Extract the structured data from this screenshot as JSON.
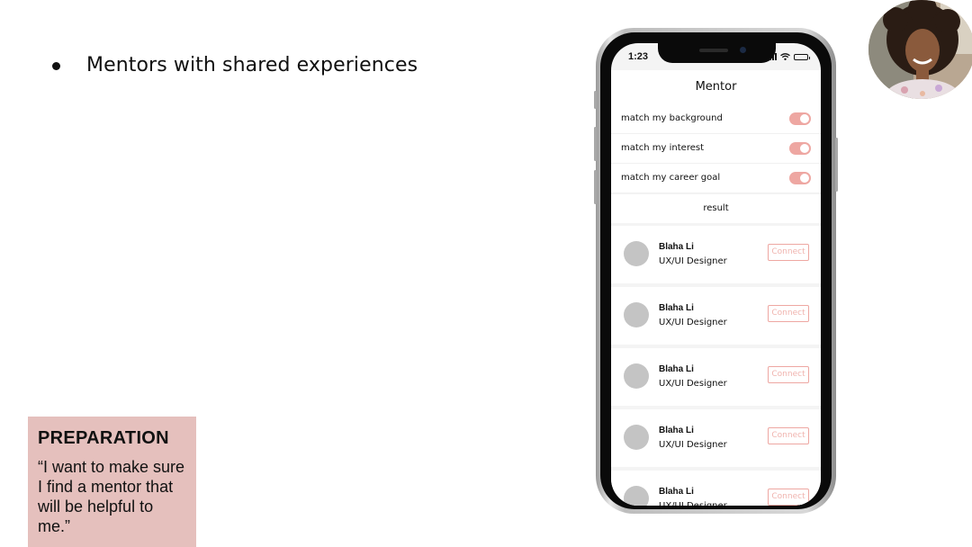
{
  "slide": {
    "bullet": "Mentors with shared experiences",
    "preparation": {
      "title": "PREPARATION",
      "quote": "“I want to make sure I find a mentor that will be helpful to me.”"
    }
  },
  "phone": {
    "status": {
      "time": "1:23"
    },
    "app": {
      "title": "Mentor",
      "toggles": [
        {
          "label": "match my background",
          "on": true
        },
        {
          "label": "match my interest",
          "on": true
        },
        {
          "label": "match my career goal",
          "on": true
        }
      ],
      "result_label": "result",
      "mentors": [
        {
          "name": "Blaha Li",
          "role": "UX/UI Designer",
          "action": "Connect"
        },
        {
          "name": "Blaha Li",
          "role": "UX/UI Designer",
          "action": "Connect"
        },
        {
          "name": "Blaha Li",
          "role": "UX/UI Designer",
          "action": "Connect"
        },
        {
          "name": "Blaha Li",
          "role": "UX/UI Designer",
          "action": "Connect"
        },
        {
          "name": "Blaha Li",
          "role": "UX/UI Designer",
          "action": "Connect"
        }
      ]
    }
  },
  "colors": {
    "accent": "#eea7a2",
    "card_background": "#e5c0bd",
    "avatar_placeholder": "#c4c4c4"
  },
  "icons": [
    "signal-icon",
    "wifi-icon",
    "battery-icon"
  ]
}
